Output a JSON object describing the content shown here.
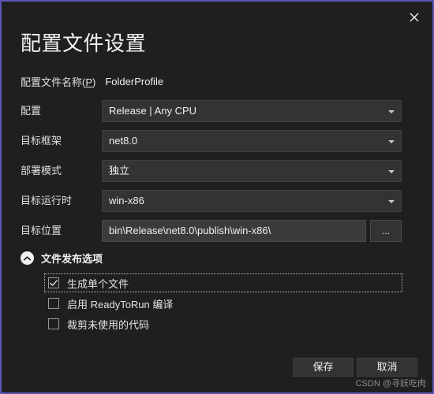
{
  "window": {
    "title": "配置文件设置",
    "close_label": "✕",
    "accent_border": "#5b55b5",
    "background": "#1f1f1f"
  },
  "profile": {
    "label_prefix": "配置文件名称(",
    "accel_key": "P",
    "label_suffix": ")",
    "value": "FolderProfile"
  },
  "form": {
    "rows": [
      {
        "label": "配置",
        "value": "Release | Any CPU",
        "type": "dropdown"
      },
      {
        "label": "目标框架",
        "value": "net8.0",
        "type": "dropdown"
      },
      {
        "label": "部署模式",
        "value": "独立",
        "type": "dropdown"
      },
      {
        "label": "目标运行时",
        "value": "win-x86",
        "type": "dropdown"
      },
      {
        "label": "目标位置",
        "value": "bin\\Release\\net8.0\\publish\\win-x86\\",
        "type": "textbox"
      }
    ],
    "browse_label": "..."
  },
  "section": {
    "title": "文件发布选项",
    "expanded": true,
    "options": [
      {
        "label": "生成单个文件",
        "checked": true,
        "focused": true
      },
      {
        "label": "启用 ReadyToRun 编译",
        "checked": false,
        "focused": false
      },
      {
        "label": "裁剪未使用的代码",
        "checked": false,
        "focused": false
      }
    ]
  },
  "footer": {
    "save_label": "保存",
    "cancel_label": "取消"
  },
  "watermark": "CSDN @寻妖吃肉"
}
